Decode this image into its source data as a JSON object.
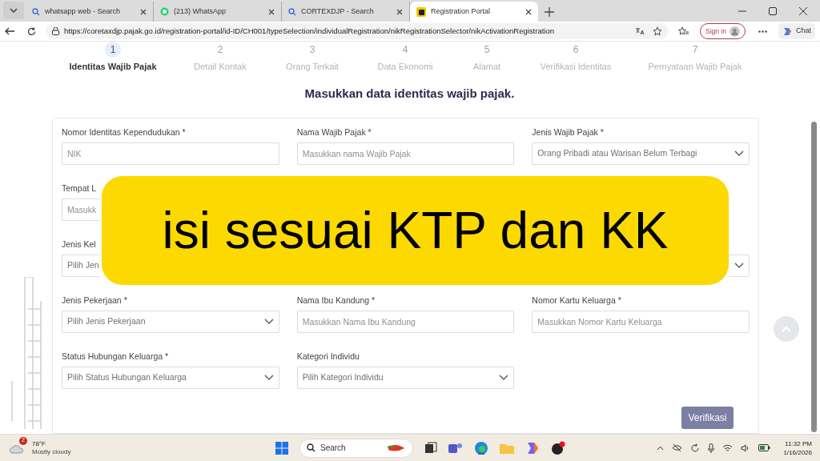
{
  "browser": {
    "tabs": [
      {
        "title": "whatsapp web - Search",
        "selected": false
      },
      {
        "title": "(213) WhatsApp",
        "selected": false
      },
      {
        "title": "CORTEXDJP - Search",
        "selected": false
      },
      {
        "title": "Registration Portal",
        "selected": true
      }
    ],
    "url": "https://coretaxdjp.pajak.go.id/registration-portal/id-ID/CH001/typeSelection/individualRegistration/nikRegistrationSelector/nikActivationRegistration",
    "sign_in": "Sign in",
    "chat": "Chat"
  },
  "steps": [
    {
      "number": "1",
      "label": "Identitas Wajib Pajak",
      "selected": true
    },
    {
      "number": "2",
      "label": "Detail Kontak",
      "selected": false
    },
    {
      "number": "3",
      "label": "Orang Terkait",
      "selected": false
    },
    {
      "number": "4",
      "label": "Data Ekonomi",
      "selected": false
    },
    {
      "number": "5",
      "label": "Alamat",
      "selected": false
    },
    {
      "number": "6",
      "label": "Verifikasi Identitas",
      "selected": false
    },
    {
      "number": "7",
      "label": "Pernyataan Wajib Pajak",
      "selected": false
    }
  ],
  "heading": "Masukkan data identitas wajib pajak.",
  "form_rows": [
    {
      "fields": [
        {
          "kind": "input",
          "label": "Nomor Identitas Kependudukan *",
          "placeholder": "NIK"
        },
        {
          "kind": "input",
          "label": "Nama Wajib Pajak *",
          "placeholder": "Masukkan nama Wajib Pajak"
        },
        {
          "kind": "select",
          "label": "Jenis Wajib Pajak *",
          "value": "Orang Pribadi atau Warisan Belum Terbagi"
        }
      ]
    },
    {
      "fields": [
        {
          "kind": "input",
          "label": "Tempat L",
          "placeholder": "Masukk"
        }
      ]
    },
    {
      "fields": [
        {
          "kind": "select",
          "label": "Jenis Kel",
          "value": "Pilih Jen"
        },
        {
          "kind": "select"
        }
      ]
    },
    {
      "fields": [
        {
          "kind": "select",
          "label": "Jenis Pekerjaan *",
          "value": "Pilih Jenis Pekerjaan"
        },
        {
          "kind": "input",
          "label": "Nama Ibu Kandung *",
          "placeholder": "Masukkan Nama Ibu Kandung"
        },
        {
          "kind": "input",
          "label": "Nomor Kartu Keluarga *",
          "placeholder": "Masukkan Nomor Kartu Keluarga"
        }
      ]
    },
    {
      "fields": [
        {
          "kind": "select",
          "label": "Status Hubungan Keluarga *",
          "value": "Pilih Status Hubungan Keluarga"
        },
        {
          "kind": "select",
          "label": "Kategori Individu",
          "value": "Pilih Kategori Individu"
        }
      ]
    }
  ],
  "submit": "Verifikasi",
  "caption": "isi sesuai KTP dan KK",
  "taskbar": {
    "temperature": "78°F",
    "weather": "Mostly cloudy",
    "weather_badge": "2",
    "search": "Search",
    "time": "11:32 PM",
    "date": "1/16/2026"
  }
}
